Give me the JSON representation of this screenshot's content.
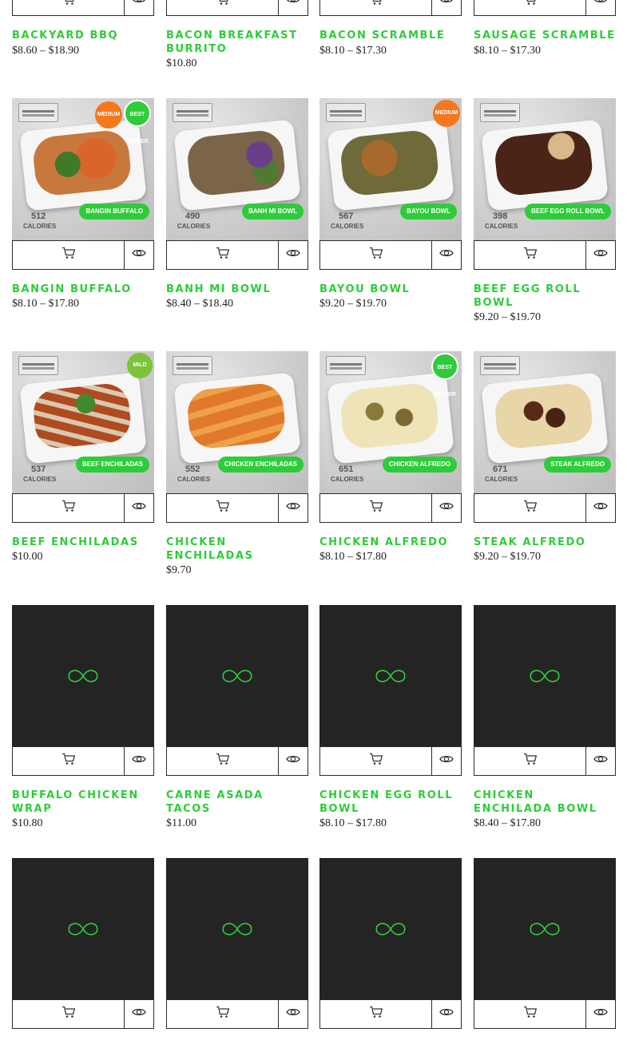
{
  "colors": {
    "accent": "#2ecc3a",
    "dark_thumb": "#242424",
    "text": "#222222"
  },
  "icons": {
    "cart": "cart-icon",
    "quick_view": "eye-icon",
    "placeholder": "infinity-icon"
  },
  "products": [
    {
      "name": "BACKYARD BBQ",
      "price": "$8.60 – $18.90"
    },
    {
      "name": "BACON BREAKFAST BURRITO",
      "price": "$10.80"
    },
    {
      "name": "BACON SCRAMBLE",
      "price": "$8.10 – $17.30"
    },
    {
      "name": "SAUSAGE SCRAMBLE",
      "price": "$8.10 – $17.30"
    },
    {
      "name": "BANGIN BUFFALO",
      "price": "$8.10 – $17.80",
      "image_label": "BANGIN BUFFALO",
      "calories": "512",
      "badges": [
        "MEDIUM",
        "BEST SELLER"
      ]
    },
    {
      "name": "BANH MI BOWL",
      "price": "$8.40 – $18.40",
      "image_label": "BANH MI BOWL",
      "calories": "490"
    },
    {
      "name": "BAYOU BOWL",
      "price": "$9.20 – $19.70",
      "image_label": "BAYOU BOWL",
      "calories": "567",
      "badges": [
        "MEDIUM"
      ]
    },
    {
      "name": "BEEF EGG ROLL BOWL",
      "price": "$9.20 – $19.70",
      "image_label": "BEEF EGG ROLL BOWL",
      "calories": "398"
    },
    {
      "name": "BEEF ENCHILADAS",
      "price": "$10.00",
      "image_label": "BEEF ENCHILADAS",
      "calories": "537",
      "badges": [
        "MILD"
      ]
    },
    {
      "name": "CHICKEN ENCHILADAS",
      "price": "$9.70",
      "image_label": "CHICKEN ENCHILADAS",
      "calories": "552"
    },
    {
      "name": "CHICKEN ALFREDO",
      "price": "$8.10 – $17.80",
      "image_label": "CHICKEN ALFREDO",
      "calories": "651",
      "badges": [
        "BEST SELLER"
      ]
    },
    {
      "name": "STEAK ALFREDO",
      "price": "$9.20 – $19.70",
      "image_label": "STEAK ALFREDO",
      "calories": "671"
    },
    {
      "name": "BUFFALO CHICKEN WRAP",
      "price": "$10.80"
    },
    {
      "name": "CARNE ASADA TACOS",
      "price": "$11.00"
    },
    {
      "name": "CHICKEN EGG ROLL BOWL",
      "price": "$8.10 – $17.80"
    },
    {
      "name": "CHICKEN ENCHILADA BOWL",
      "price": "$8.40 – $17.80"
    }
  ],
  "calories_label": "CALORIES"
}
